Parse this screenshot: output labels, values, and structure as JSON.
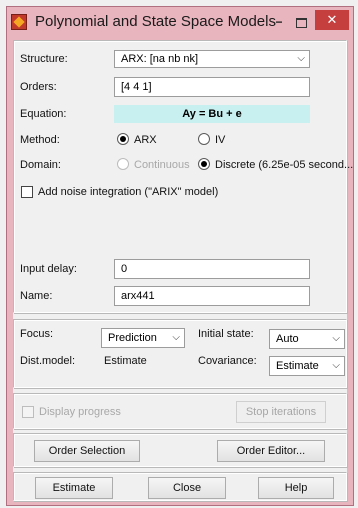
{
  "window": {
    "title": "Polynomial and State Space Models",
    "minimize": "−",
    "close": "✕"
  },
  "model": {
    "structure_label": "Structure:",
    "structure_value": "ARX: [na nb nk]",
    "orders_label": "Orders:",
    "orders_value": "[4 4 1]",
    "equation_label": "Equation:",
    "equation_value": "Ay = Bu + e",
    "method_label": "Method:",
    "method_options": [
      "ARX",
      "IV"
    ],
    "method_selected": "ARX",
    "domain_label": "Domain:",
    "domain_continuous": "Continuous",
    "domain_discrete": "Discrete (6.25e-05 second...",
    "noise_integration_label": "Add noise integration (\"ARIX\" model)",
    "input_delay_label": "Input delay:",
    "input_delay_value": "0",
    "name_label": "Name:",
    "name_value": "arx441"
  },
  "options": {
    "focus_label": "Focus:",
    "focus_value": "Prediction",
    "initial_state_label": "Initial state:",
    "initial_state_value": "Auto",
    "dist_model_label": "Dist.model:",
    "dist_model_value": "Estimate",
    "covariance_label": "Covariance:",
    "covariance_value": "Estimate"
  },
  "progress": {
    "display_progress_label": "Display progress",
    "stop_iterations_label": "Stop iterations"
  },
  "order_buttons": {
    "order_selection": "Order Selection",
    "order_editor": "Order Editor..."
  },
  "actions": {
    "estimate": "Estimate",
    "close": "Close",
    "help": "Help"
  },
  "colors": {
    "titlebar": "#e8b4bd",
    "equation_bg": "#c8f0f0",
    "close_button": "#c63f3f"
  },
  "icons": [
    "matlab-app-icon",
    "dropdown-arrow-icon"
  ]
}
